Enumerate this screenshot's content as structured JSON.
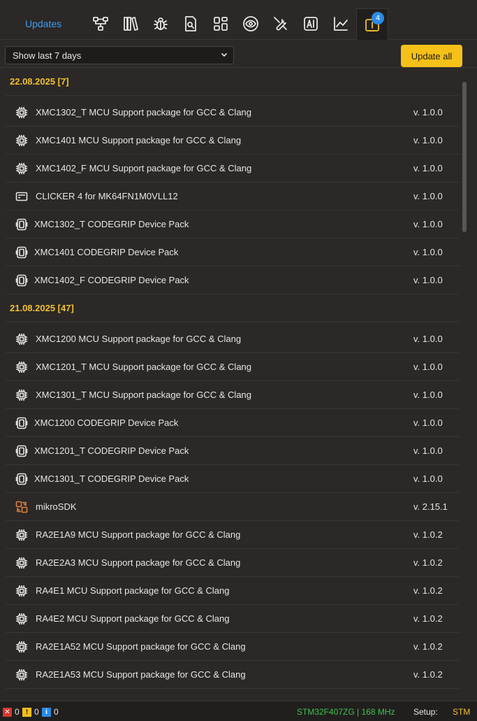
{
  "header": {
    "updates_tab": "Updates",
    "badge_count": "4",
    "tools": [
      "network-icon",
      "library-icon",
      "bug-icon",
      "search-doc-icon",
      "layout-icon",
      "eye-icon",
      "tools-icon",
      "ai-icon",
      "chart-icon",
      "update-info-icon"
    ]
  },
  "filter": {
    "selected": "Show last 7 days",
    "update_all": "Update all"
  },
  "groups": [
    {
      "header": "22.08.2025 [7]",
      "items": [
        {
          "icon": "chip",
          "name": "XMC1302_T MCU Support package for GCC & Clang",
          "version": "v. 1.0.0"
        },
        {
          "icon": "chip",
          "name": "XMC1401 MCU Support package for GCC & Clang",
          "version": "v. 1.0.0"
        },
        {
          "icon": "chip",
          "name": "XMC1402_F MCU Support package for GCC & Clang",
          "version": "v. 1.0.0"
        },
        {
          "icon": "board",
          "name": "CLICKER 4 for MK64FN1M0VLL12",
          "version": "v. 1.0.0"
        },
        {
          "icon": "device",
          "name": "XMC1302_T CODEGRIP Device Pack",
          "version": "v. 1.0.0"
        },
        {
          "icon": "device",
          "name": "XMC1401 CODEGRIP Device Pack",
          "version": "v. 1.0.0"
        },
        {
          "icon": "device",
          "name": "XMC1402_F CODEGRIP Device Pack",
          "version": "v. 1.0.0"
        }
      ]
    },
    {
      "header": "21.08.2025 [47]",
      "items": [
        {
          "icon": "chip",
          "name": "XMC1200 MCU Support package for GCC & Clang",
          "version": "v. 1.0.0"
        },
        {
          "icon": "chip",
          "name": "XMC1201_T MCU Support package for GCC & Clang",
          "version": "v. 1.0.0"
        },
        {
          "icon": "chip",
          "name": "XMC1301_T MCU Support package for GCC & Clang",
          "version": "v. 1.0.0"
        },
        {
          "icon": "device",
          "name": "XMC1200 CODEGRIP Device Pack",
          "version": "v. 1.0.0"
        },
        {
          "icon": "device",
          "name": "XMC1201_T CODEGRIP Device Pack",
          "version": "v. 1.0.0"
        },
        {
          "icon": "device",
          "name": "XMC1301_T CODEGRIP Device Pack",
          "version": "v. 1.0.0"
        },
        {
          "icon": "sdk",
          "name": "mikroSDK",
          "version": "v. 2.15.1"
        },
        {
          "icon": "chip",
          "name": "RA2E1A9 MCU Support package for GCC & Clang",
          "version": "v. 1.0.2"
        },
        {
          "icon": "chip",
          "name": "RA2E2A3 MCU Support package for GCC & Clang",
          "version": "v. 1.0.2"
        },
        {
          "icon": "chip",
          "name": "RA4E1 MCU Support package for GCC & Clang",
          "version": "v. 1.0.2"
        },
        {
          "icon": "chip",
          "name": "RA4E2 MCU Support package for GCC & Clang",
          "version": "v. 1.0.2"
        },
        {
          "icon": "chip",
          "name": "RA2E1A52 MCU Support package for GCC & Clang",
          "version": "v. 1.0.2"
        },
        {
          "icon": "chip",
          "name": "RA2E1A53 MCU Support package for GCC & Clang",
          "version": "v. 1.0.2"
        }
      ]
    }
  ],
  "status": {
    "errors": "0",
    "warnings": "0",
    "infos": "0",
    "error_glyph": "✕",
    "warning_glyph": "!",
    "info_glyph": "i",
    "chip": "STM32F407ZG | 168 MHz",
    "setup_label": "Setup:",
    "setup_value": "STM"
  },
  "colors": {
    "accent": "#f2c12e",
    "link": "#3f9cf0",
    "chip_text": "#3ec24f",
    "background": "#2b2827"
  }
}
